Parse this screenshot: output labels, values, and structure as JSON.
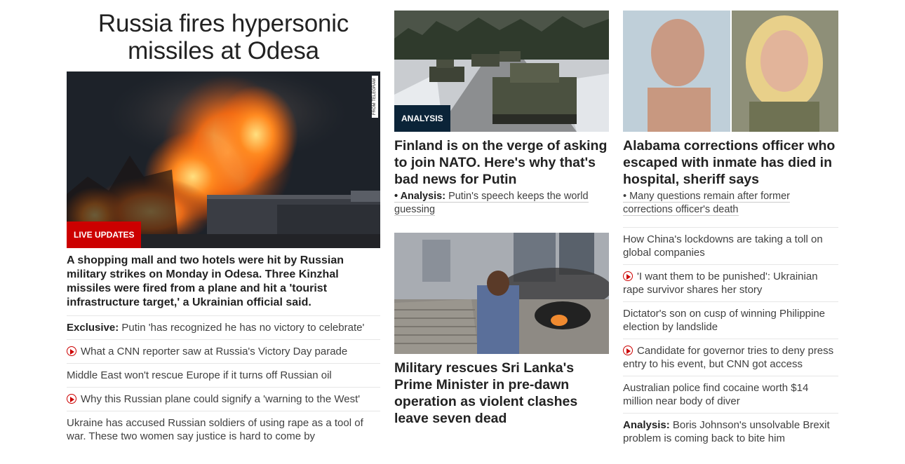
{
  "hero": {
    "title": "Russia fires hypersonic missiles at Odesa",
    "image_alt": "Fire at night in Odesa",
    "credit": "FROM TELEGRAM",
    "badge": "LIVE UPDATES",
    "description": "A shopping mall and two hotels were hit by Russian military strikes on Monday in Odesa. Three Kinzhal missiles were fired from a plane and hit a 'tourist infrastructure target,' a Ukrainian official said."
  },
  "left_list": [
    {
      "prefix": "Exclusive:",
      "text": " Putin 'has recognized he has no victory to celebrate'",
      "video": false
    },
    {
      "prefix": "",
      "text": "What a CNN reporter saw at Russia's Victory Day parade",
      "video": true
    },
    {
      "prefix": "",
      "text": "Middle East won't rescue Europe if it turns off Russian oil",
      "video": false
    },
    {
      "prefix": "",
      "text": "Why this Russian plane could signify a 'warning to the West'",
      "video": true
    },
    {
      "prefix": "",
      "text": "Ukraine has accused Russian soldiers of using rape as a tool of war. These two women say justice is hard to come by",
      "video": false
    }
  ],
  "mid_card1": {
    "badge": "ANALYSIS",
    "title": "Finland is on the verge of asking to join NATO. Here's why that's bad news for Putin",
    "sub_prefix": "• Analysis:",
    "sub_text": " Putin's speech keeps the world guessing"
  },
  "mid_card2": {
    "title": "Military rescues Sri Lanka's Prime Minister in pre-dawn operation as violent clashes leave seven dead"
  },
  "right_card": {
    "title": "Alabama corrections officer who escaped with inmate has died in hospital, sheriff says",
    "sub_text": "• Many questions remain after former corrections officer's death"
  },
  "right_list": [
    {
      "prefix": "",
      "text": "How China's lockdowns are taking a toll on global companies",
      "video": false
    },
    {
      "prefix": "",
      "text": "'I want them to be punished': Ukrainian rape survivor shares her story",
      "video": true
    },
    {
      "prefix": "",
      "text": "Dictator's son on cusp of winning Philippine election by landslide",
      "video": false
    },
    {
      "prefix": "",
      "text": "Candidate for governor tries to deny press entry to his event, but CNN got access",
      "video": true
    },
    {
      "prefix": "",
      "text": "Australian police find cocaine worth $14 million near body of diver",
      "video": false
    },
    {
      "prefix": "Analysis:",
      "text": " Boris Johnson's unsolvable Brexit problem is coming back to bite him",
      "video": false
    }
  ],
  "colors": {
    "live_red": "#cc0000",
    "analysis_navy": "#0b2438"
  },
  "icons": {
    "video": "play-circle-icon"
  }
}
